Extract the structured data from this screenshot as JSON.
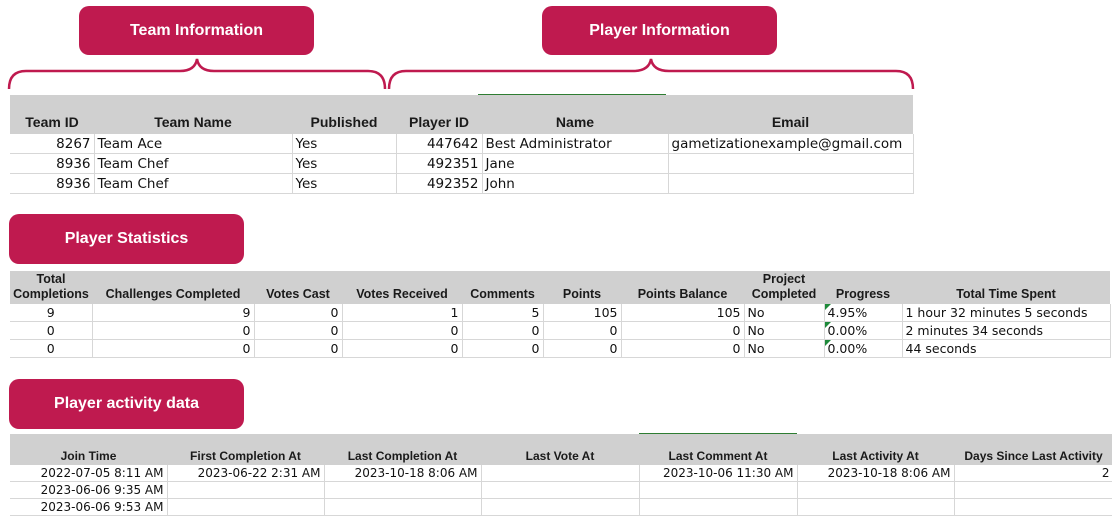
{
  "sections": {
    "team_info": "Team Information",
    "player_info": "Player Information",
    "player_stats": "Player Statistics",
    "player_activity": "Player activity data"
  },
  "colors": {
    "accent": "#bf1a4f",
    "header_bg": "#d0d0d0",
    "green_marker": "#1e8a3a"
  },
  "team_table": {
    "headers": [
      "Team ID",
      "Team Name",
      "Published",
      "Player ID",
      "Name",
      "Email"
    ],
    "rows": [
      [
        "8267",
        "Team Ace",
        "Yes",
        "447642",
        "Best Administrator",
        "gametizationexample@gmail.com"
      ],
      [
        "8936",
        "Team Chef",
        "Yes",
        "492351",
        "Jane",
        ""
      ],
      [
        "8936",
        "Team Chef",
        "Yes",
        "492352",
        "John",
        ""
      ]
    ]
  },
  "stats_table": {
    "headers": [
      "Total Completions",
      "Challenges Completed",
      "Votes Cast",
      "Votes Received",
      "Comments",
      "Points",
      "Points Balance",
      "Project Completed",
      "Progress",
      "Total Time Spent"
    ],
    "rows": [
      [
        "9",
        "9",
        "0",
        "1",
        "5",
        "105",
        "105",
        "No",
        "4.95%",
        "1 hour 32 minutes 5 seconds"
      ],
      [
        "0",
        "0",
        "0",
        "0",
        "0",
        "0",
        "0",
        "No",
        "0.00%",
        "2 minutes 34 seconds"
      ],
      [
        "0",
        "0",
        "0",
        "0",
        "0",
        "0",
        "0",
        "No",
        "0.00%",
        "44 seconds"
      ]
    ]
  },
  "activity_table": {
    "headers": [
      "Join Time",
      "First Completion At",
      "Last Completion At",
      "Last Vote At",
      "Last Comment At",
      "Last Activity At",
      "Days Since Last Activity"
    ],
    "rows": [
      [
        "2022-07-05 8:11 AM",
        "2023-06-22 2:31 AM",
        "2023-10-18 8:06 AM",
        "",
        "2023-10-06 11:30 AM",
        "2023-10-18 8:06 AM",
        "2"
      ],
      [
        "2023-06-06 9:35 AM",
        "",
        "",
        "",
        "",
        "",
        ""
      ],
      [
        "2023-06-06 9:53 AM",
        "",
        "",
        "",
        "",
        "",
        ""
      ]
    ]
  }
}
